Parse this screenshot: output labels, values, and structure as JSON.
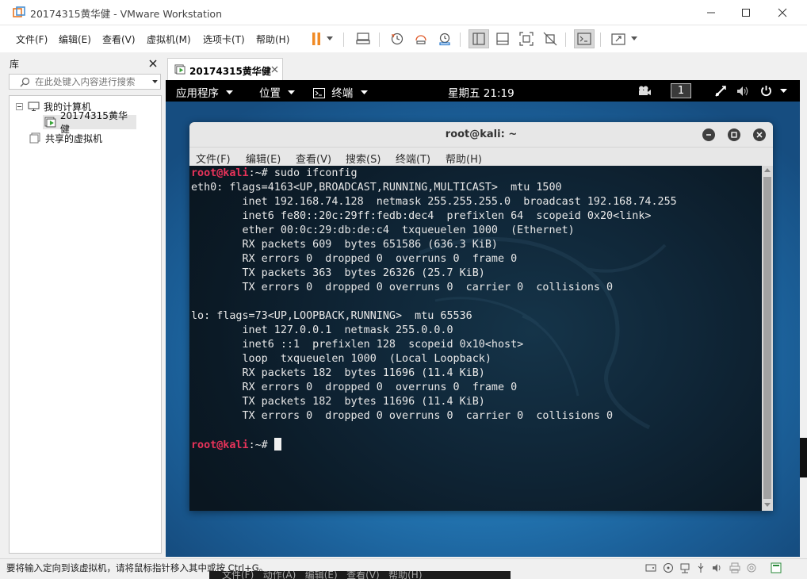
{
  "window": {
    "title": "20174315黄华健 - VMware Workstation",
    "controls": [
      "minimize-icon",
      "maximize-icon",
      "close-icon"
    ]
  },
  "menubar": {
    "items": [
      "文件(F)",
      "编辑(E)",
      "查看(V)",
      "虚拟机(M)",
      "选项卡(T)",
      "帮助(H)"
    ]
  },
  "toolbar": {
    "icons": [
      "pause-icon",
      "dropdown-icon",
      "send-ctrl-alt-del-icon",
      "snapshot-icon",
      "revert-snapshot-icon",
      "snapshot-manager-icon",
      "library-view-icon",
      "thumbnail-view-icon",
      "fullscreen-icon",
      "unity-icon",
      "console-view-icon",
      "stretch-icon",
      "dropdown-icon"
    ]
  },
  "library": {
    "title": "库",
    "search_placeholder": "在此处键入内容进行搜索",
    "tree": [
      {
        "label": "我的计算机",
        "level": 0,
        "expanded": true
      },
      {
        "label": "20174315黄华健",
        "level": 1,
        "selected": true
      },
      {
        "label": "共享的虚拟机",
        "level": 0
      }
    ]
  },
  "tabs": [
    {
      "label": "20174315黄华健",
      "active": true
    }
  ],
  "guest": {
    "topbar": {
      "applications": "应用程序",
      "places": "位置",
      "terminal": "终端",
      "clock": "星期五 21:19",
      "workspace": "1"
    },
    "terminal": {
      "title": "root@kali: ~",
      "menu": [
        "文件(F)",
        "编辑(E)",
        "查看(V)",
        "搜索(S)",
        "终端(T)",
        "帮助(H)"
      ],
      "prompt_user": "root@kali",
      "prompt_rest": ":~# ",
      "command": "sudo ifconfig",
      "output": [
        "eth0: flags=4163<UP,BROADCAST,RUNNING,MULTICAST>  mtu 1500",
        "        inet 192.168.74.128  netmask 255.255.255.0  broadcast 192.168.74.255",
        "        inet6 fe80::20c:29ff:fedb:dec4  prefixlen 64  scopeid 0x20<link>",
        "        ether 00:0c:29:db:de:c4  txqueuelen 1000  (Ethernet)",
        "        RX packets 609  bytes 651586 (636.3 KiB)",
        "        RX errors 0  dropped 0  overruns 0  frame 0",
        "        TX packets 363  bytes 26326 (25.7 KiB)",
        "        TX errors 0  dropped 0 overruns 0  carrier 0  collisions 0",
        "",
        "lo: flags=73<UP,LOOPBACK,RUNNING>  mtu 65536",
        "        inet 127.0.0.1  netmask 255.0.0.0",
        "        inet6 ::1  prefixlen 128  scopeid 0x10<host>",
        "        loop  txqueuelen 1000  (Local Loopback)",
        "        RX packets 182  bytes 11696 (11.4 KiB)",
        "        RX errors 0  dropped 0  overruns 0  frame 0",
        "        TX packets 182  bytes 11696 (11.4 KiB)",
        "        TX errors 0  dropped 0 overruns 0  carrier 0  collisions 0",
        ""
      ]
    }
  },
  "status": {
    "message": "要将输入定向到该虚拟机，请将鼠标指针移入其中或按 Ctrl+G。"
  },
  "background_window": {
    "menu_text": "文件(F)   动作(A)   编辑(E)   查看(V)   帮助(H)"
  },
  "colors": {
    "prompt_user": "#e8335a",
    "vm_background": "#2479b6",
    "accent_pause": "#f08a24"
  }
}
